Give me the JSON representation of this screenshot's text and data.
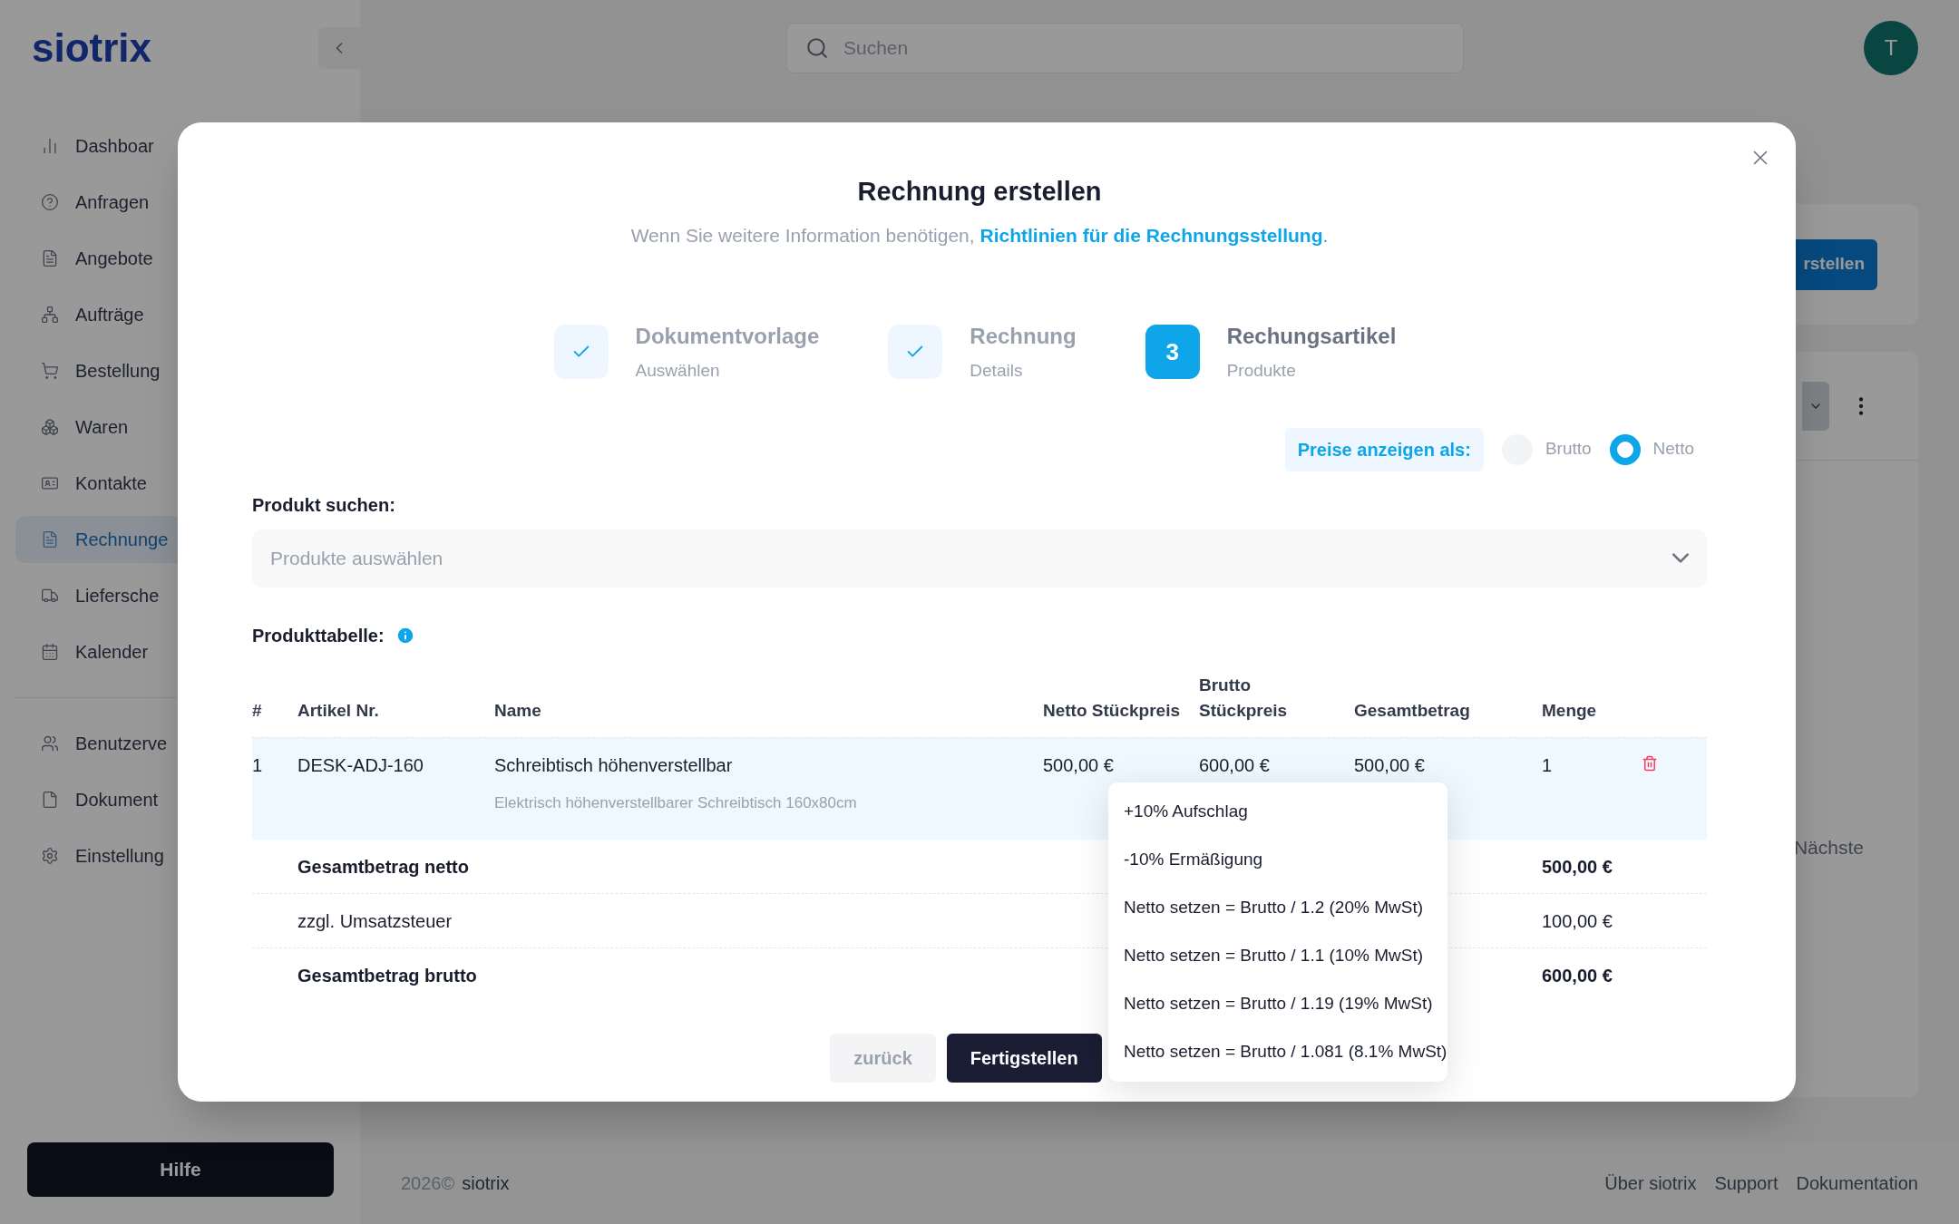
{
  "app": {
    "logo": "siotrix"
  },
  "sidebar": {
    "items": [
      {
        "label": "Dashboar",
        "selected": false
      },
      {
        "label": "Anfragen",
        "selected": false
      },
      {
        "label": "Angebote",
        "selected": false
      },
      {
        "label": "Aufträge",
        "selected": false
      },
      {
        "label": "Bestellung",
        "selected": false
      },
      {
        "label": "Waren",
        "selected": false
      },
      {
        "label": "Kontakte",
        "selected": false
      },
      {
        "label": "Rechnunge",
        "selected": true
      },
      {
        "label": "Liefersche",
        "selected": false
      },
      {
        "label": "Kalender",
        "selected": false
      }
    ],
    "admin_items": [
      {
        "label": "Benutzerve",
        "selected": false
      },
      {
        "label": "Dokument",
        "selected": false
      },
      {
        "label": "Einstellung",
        "selected": false
      }
    ],
    "help_button": "Hilfe"
  },
  "topbar": {
    "search": {
      "placeholder": "Suchen"
    },
    "avatar": "T"
  },
  "background": {
    "create_button": "rstellen",
    "pager_next": "Nächste"
  },
  "footer": {
    "year": "2026©",
    "brand": "siotrix",
    "links": [
      "Über siotrix",
      "Support",
      "Dokumentation"
    ]
  },
  "modal": {
    "title": "Rechnung erstellen",
    "subtitle": "Wenn Sie weitere Information benötigen,",
    "link": "Richtlinien für die Rechnungsstellung",
    "subtitle_end": ".",
    "steps": [
      {
        "done": true,
        "title": "Dokumentvorlage",
        "subtitle": "Auswählen"
      },
      {
        "done": true,
        "title": "Rechnung",
        "subtitle": "Details"
      },
      {
        "done": false,
        "number": "3",
        "title": "Rechungsartikel",
        "subtitle": "Produkte"
      }
    ],
    "price_toggle": {
      "label": "Preise anzeigen als:",
      "options": [
        {
          "label": "Brutto",
          "selected": false
        },
        {
          "label": "Netto",
          "selected": true
        }
      ]
    },
    "product_search": {
      "label": "Produkt suchen:",
      "placeholder": "Produkte auswählen"
    },
    "table": {
      "label": "Produkttabelle:",
      "columns": [
        "#",
        "Artikel Nr.",
        "Name",
        "Netto Stückpreis",
        "Brutto Stückpreis",
        "Gesamtbetrag",
        "Menge"
      ],
      "rows": [
        {
          "number": "1",
          "article": "DESK-ADJ-160",
          "name": "Schreibtisch höhenverstellbar",
          "description": "Elektrisch höhenverstellbarer Schreibtisch 160x80cm",
          "netto": "500,00 €",
          "brutto": "600,00 €",
          "total": "500,00 €",
          "quantity": "1"
        }
      ],
      "summary": [
        {
          "label": "Gesamtbetrag netto",
          "value": "500,00 €",
          "bold": true
        },
        {
          "label": "zzgl. Umsatzsteuer",
          "value": "100,00 €",
          "bold": false
        },
        {
          "label": "Gesamtbetrag brutto",
          "value": "600,00 €",
          "bold": true
        }
      ]
    },
    "buttons": {
      "back": "zurück",
      "finish": "Fertigstellen"
    },
    "menu": {
      "items": [
        "+10% Aufschlag",
        "-10% Ermäßigung",
        "Netto setzen = Brutto / 1.2 (20% MwSt)",
        "Netto setzen = Brutto / 1.1 (10% MwSt)",
        "Netto setzen = Brutto / 1.19 (19% MwSt)",
        "Netto setzen = Brutto / 1.081 (8.1% MwSt)"
      ]
    }
  }
}
